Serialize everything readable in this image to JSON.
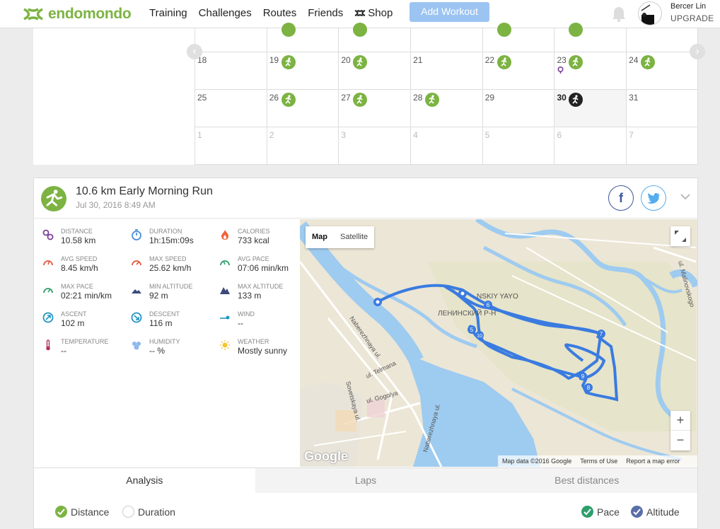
{
  "header": {
    "brand": "endomondo",
    "nav": [
      "Training",
      "Challenges",
      "Routes",
      "Friends",
      "Shop"
    ],
    "add_workout": "Add Workout",
    "user_name": "Bercer Lin",
    "upgrade": "UPGRADE"
  },
  "calendar": {
    "row1": [
      "",
      "",
      "",
      "",
      "",
      "",
      ""
    ],
    "row2": [
      "18",
      "19",
      "20",
      "21",
      "22",
      "23",
      "24"
    ],
    "row3": [
      "25",
      "26",
      "27",
      "28",
      "29",
      "30",
      "31"
    ],
    "row4": [
      "1",
      "2",
      "3",
      "4",
      "5",
      "6",
      "7"
    ]
  },
  "workout": {
    "title": "10.6 km Early Morning Run",
    "date": "Jul 30, 2016 8:49 AM",
    "facebook": "f",
    "stats": [
      {
        "label": "DISTANCE",
        "value": "10.58 km"
      },
      {
        "label": "DURATION",
        "value": "1h:15m:09s"
      },
      {
        "label": "CALORIES",
        "value": "733 kcal"
      },
      {
        "label": "AVG SPEED",
        "value": "8.45 km/h"
      },
      {
        "label": "MAX SPEED",
        "value": "25.62 km/h"
      },
      {
        "label": "AVG PACE",
        "value": "07:06 min/km"
      },
      {
        "label": "MAX PACE",
        "value": "02:21 min/km"
      },
      {
        "label": "MIN ALTITUDE",
        "value": "92 m"
      },
      {
        "label": "MAX ALTITUDE",
        "value": "133 m"
      },
      {
        "label": "ASCENT",
        "value": "102 m"
      },
      {
        "label": "DESCENT",
        "value": "116 m"
      },
      {
        "label": "WIND",
        "value": "--"
      },
      {
        "label": "TEMPERATURE",
        "value": "--"
      },
      {
        "label": "HUMIDITY",
        "value": "-- %"
      },
      {
        "label": "WEATHER",
        "value": "Mostly sunny"
      }
    ]
  },
  "map": {
    "map_label": "Map",
    "satellite_label": "Satellite",
    "zoom_in": "+",
    "zoom_out": "−",
    "google": "Google",
    "attribution": "Map data ©2016 Google",
    "terms": "Terms of Use",
    "report": "Report a map error",
    "street_labels": [
      "Naberezhnaya ul.",
      "ul. Telmana",
      "Sovetskaya ul.",
      "ul. Gogolya",
      "Naberezhnaya ul.",
      "ul. Malinovskogo",
      "ЛЕНИНСКИЙ Р-Н",
      "NSKIY YAYO"
    ],
    "markers": [
      "6",
      "5",
      "10",
      "7",
      "9",
      "8"
    ]
  },
  "tabs": [
    "Analysis",
    "Laps",
    "Best distances"
  ],
  "legend": {
    "distance": "Distance",
    "duration": "Duration",
    "pace": "Pace",
    "altitude": "Altitude"
  },
  "colors": {
    "accent_green": "#7cb342",
    "route_blue": "#3a7be0",
    "water": "#9ecbf0"
  }
}
